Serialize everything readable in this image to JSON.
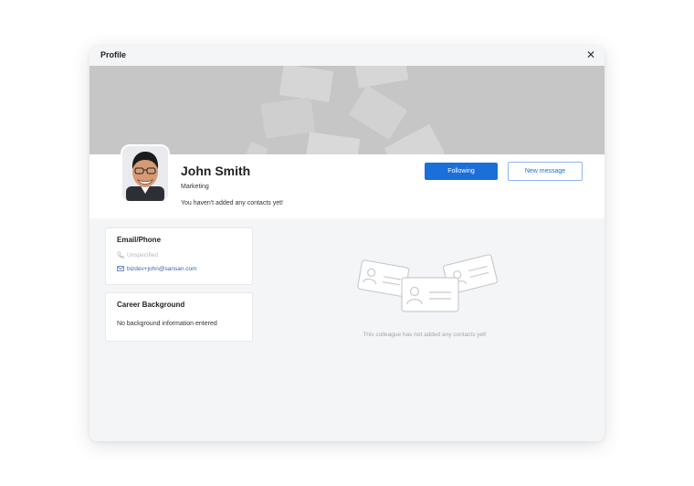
{
  "window": {
    "title": "Profile",
    "close_glyph": "✕"
  },
  "profile": {
    "name": "John Smith",
    "department": "Marketing",
    "contacts_note": "You haven't added any contacts yet!",
    "avatar_alt": "avatar"
  },
  "actions": {
    "following_label": "Following",
    "message_label": "New message"
  },
  "email_phone": {
    "title": "Email/Phone",
    "phone": "Unspecified",
    "email": "bizdev+john@sansan.com",
    "phone_icon": "phone-icon",
    "email_icon": "mail-icon"
  },
  "career": {
    "title": "Career Background",
    "text": "No background information entered"
  },
  "empty_state": {
    "text": "This colleague has not added any contacts yet!"
  },
  "colors": {
    "accent": "#1a6fd9",
    "banner": "#c6c6c6",
    "background": "#f4f5f7"
  }
}
